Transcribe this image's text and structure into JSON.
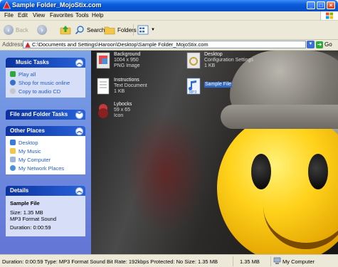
{
  "window": {
    "title": "Sample Folder_MojoStix.com",
    "controls": [
      "_",
      "□",
      "×"
    ]
  },
  "menu": [
    "File",
    "Edit",
    "View",
    "Favorites",
    "Tools",
    "Help"
  ],
  "toolbar": {
    "back": "Back",
    "search": "Search",
    "folders": "Folders"
  },
  "address": {
    "label": "Address",
    "path": "C:\\Documents and Settings\\Haroon\\Desktop\\Sample Folder_MojoStix.com",
    "go": "Go"
  },
  "sidebar": {
    "music_tasks": {
      "title": "Music Tasks",
      "items": [
        "Play all",
        "Shop for music online",
        "Copy to audio CD"
      ]
    },
    "file_folder_tasks": {
      "title": "File and Folder Tasks"
    },
    "other_places": {
      "title": "Other Places",
      "items": [
        "Desktop",
        "My Music",
        "My Computer",
        "My Network Places"
      ]
    },
    "details": {
      "title": "Details",
      "name": "Sample File",
      "size": "Size: 1.35 MB",
      "format": "MP3 Format Sound",
      "duration": "Duration: 0:00:59"
    }
  },
  "files": [
    {
      "name": "Background",
      "line2": "1004 x 950",
      "line3": "PNG Image"
    },
    {
      "name": "Desktop",
      "line2": "Configuration Settings",
      "line3": "1 KB"
    },
    {
      "name": "Instructions",
      "line2": "Text Document",
      "line3": "1 KB"
    },
    {
      "name": "Sample File",
      "line2": "",
      "line3": ""
    },
    {
      "name": "Lybocks",
      "line2": "59 x 65",
      "line3": "Icon"
    }
  ],
  "status": {
    "info": "Duration: 0:00:59 Type: MP3 Format Sound Bit Rate: 192kbps Protected: No Size: 1.35 MB",
    "size": "1.35 MB",
    "location": "My Computer"
  },
  "colors": {
    "titlebar": "#0a5ddb",
    "sidebar": "#6c8ee0",
    "selection": "#316ac5"
  }
}
